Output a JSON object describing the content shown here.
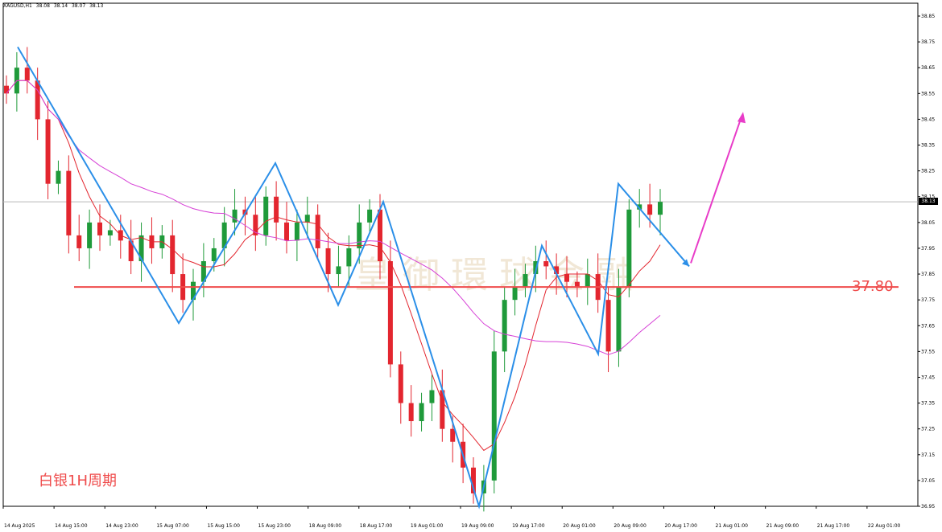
{
  "header": {
    "symbol": "XAGUSD,H1",
    "open": "38.08",
    "high": "38.14",
    "low": "38.07",
    "close": "38.13"
  },
  "watermark": {
    "text": "皇御環球金融"
  },
  "annotations": {
    "level_label": "37.80",
    "caption": "白银1H周期"
  },
  "current_price": "38.13",
  "colors": {
    "bull_candle": "#1f9a3a",
    "bear_candle": "#e3262f",
    "zigzag": "#2b8fe8",
    "support_line": "#ef4b4b",
    "ma_fast": "#e3262f",
    "ma_slow": "#d640d6",
    "forecast_arrow": "#e83cc8",
    "current_price_line": "#b7b7b7"
  },
  "chart_data": {
    "type": "candlestick",
    "ylim": [
      36.95,
      38.85
    ],
    "price_ticks": [
      "38.85",
      "38.75",
      "38.65",
      "38.55",
      "38.45",
      "38.35",
      "38.25",
      "38.15",
      "38.05",
      "37.95",
      "37.85",
      "37.75",
      "37.65",
      "37.55",
      "37.45",
      "37.35",
      "37.25",
      "37.15",
      "37.05",
      "36.95"
    ],
    "time_ticks": [
      "14 Aug 2025",
      "14 Aug 15:00",
      "14 Aug 23:00",
      "15 Aug 07:00",
      "15 Aug 15:00",
      "15 Aug 23:00",
      "18 Aug 09:00",
      "18 Aug 17:00",
      "19 Aug 01:00",
      "19 Aug 09:00",
      "19 Aug 17:00",
      "20 Aug 01:00",
      "20 Aug 09:00",
      "20 Aug 17:00",
      "21 Aug 01:00",
      "21 Aug 09:00",
      "21 Aug 17:00",
      "22 Aug 01:00"
    ],
    "support_level": 37.8,
    "zigzag_points": [
      38.73,
      37.66,
      38.28,
      37.73,
      38.13,
      36.95,
      37.96,
      37.54,
      38.2,
      37.88
    ],
    "forecast_target": 38.46,
    "close_path": [
      38.55,
      38.65,
      38.6,
      38.45,
      38.2,
      38.25,
      38.0,
      37.95,
      38.05,
      38.0,
      38.02,
      37.98,
      37.9,
      38.0,
      37.95,
      38.0,
      37.85,
      37.75,
      37.82,
      37.9,
      37.95,
      38.05,
      38.1,
      38.08,
      38.0,
      38.15,
      38.05,
      37.98,
      38.05,
      38.08,
      37.95,
      37.85,
      37.88,
      37.95,
      38.05,
      38.1,
      37.9,
      37.5,
      37.35,
      37.28,
      37.35,
      37.4,
      37.25,
      37.2,
      37.1,
      37.0,
      37.05,
      37.55,
      37.75,
      37.8,
      37.85,
      37.9,
      37.88,
      37.85,
      37.82,
      37.8,
      37.85,
      37.75,
      37.55,
      37.8,
      38.1,
      38.12,
      38.08,
      38.13
    ]
  }
}
